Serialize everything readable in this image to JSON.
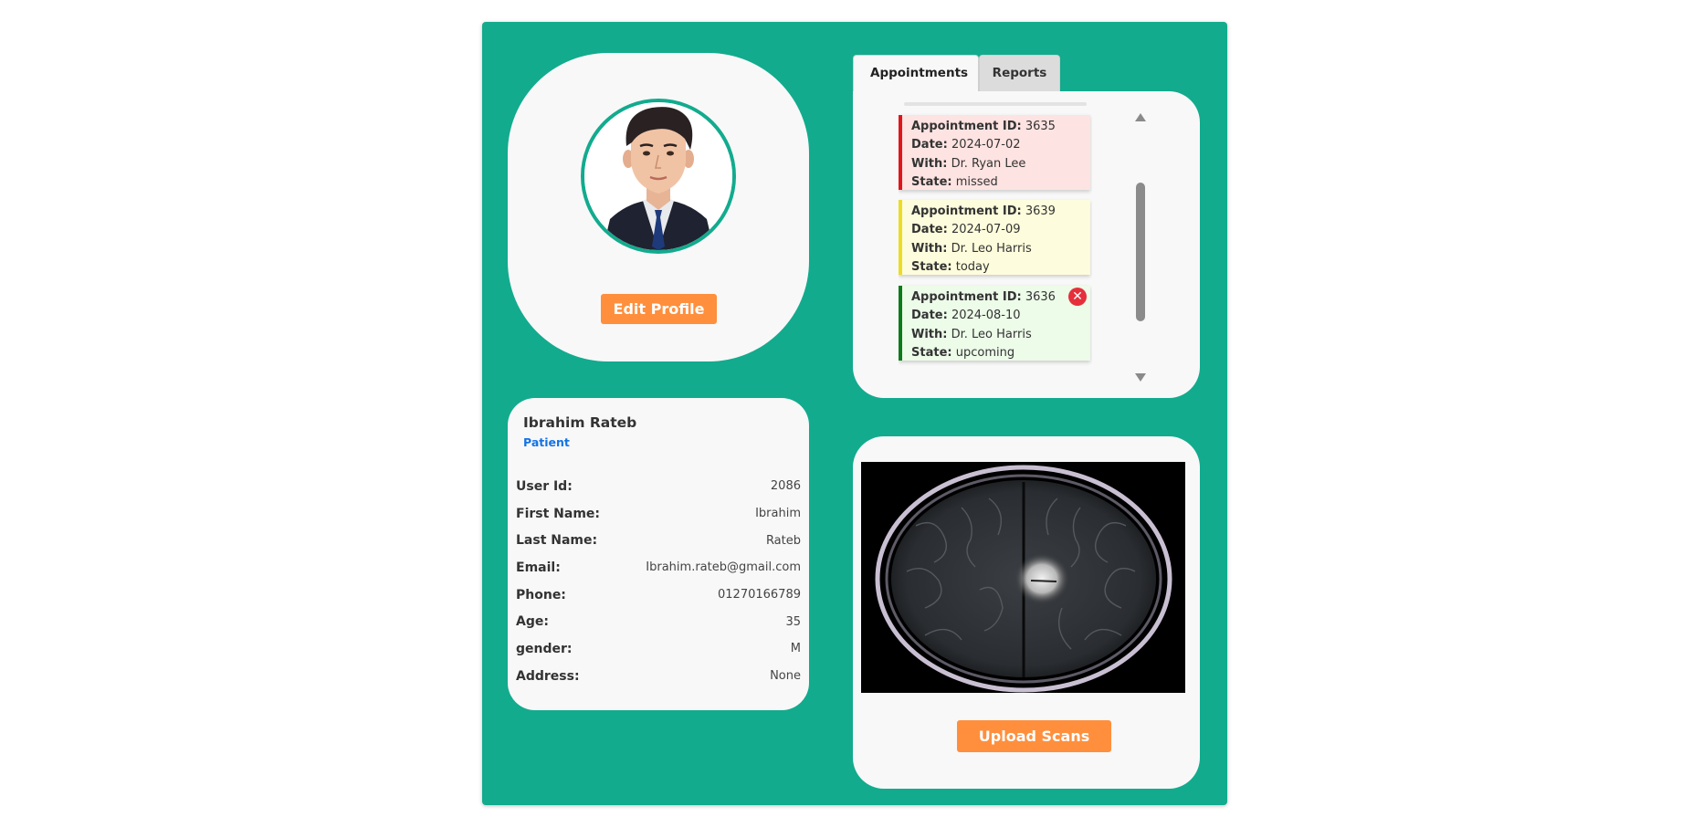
{
  "profile": {
    "edit_button": "Edit Profile"
  },
  "user": {
    "name": "Ibrahim Rateb",
    "role": "Patient",
    "fields": [
      {
        "label": "User Id:",
        "value": "2086"
      },
      {
        "label": "First Name:",
        "value": "Ibrahim"
      },
      {
        "label": "Last Name:",
        "value": "Rateb"
      },
      {
        "label": "Email:",
        "value": "Ibrahim.rateb@gmail.com"
      },
      {
        "label": "Phone:",
        "value": "01270166789"
      },
      {
        "label": "Age:",
        "value": "35"
      },
      {
        "label": "gender:",
        "value": "M"
      },
      {
        "label": "Address:",
        "value": "None"
      }
    ]
  },
  "tabs": {
    "appointments": "Appointments",
    "reports": "Reports",
    "active": "Appointments"
  },
  "appointment_labels": {
    "id": "Appointment ID:",
    "date": "Date:",
    "with": "With:",
    "state": "State:"
  },
  "appointments": [
    {
      "id": "3635",
      "date": "2024-07-02",
      "with": "Dr. Ryan Lee",
      "state": "missed",
      "color": "#e0151c"
    },
    {
      "id": "3639",
      "date": "2024-07-09",
      "with": "Dr. Leo Harris",
      "state": "today",
      "color": "#ecdc22"
    },
    {
      "id": "3636",
      "date": "2024-08-10",
      "with": "Dr. Leo Harris",
      "state": "upcoming",
      "color": "#0d7b1a",
      "cancel_icon": "close-circle-icon"
    }
  ],
  "scans": {
    "upload_button": "Upload Scans"
  },
  "colors": {
    "panel": "#12ab8e",
    "accent_button": "#ff8f3c",
    "role_text": "#1473e6"
  }
}
